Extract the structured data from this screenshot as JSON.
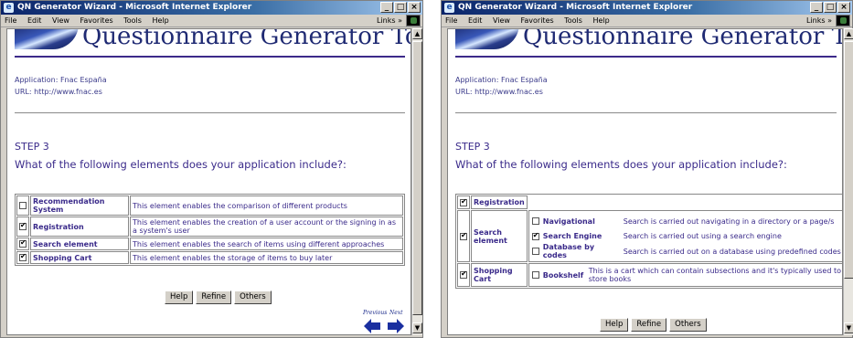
{
  "left": {
    "window_title": "QN Generator Wizard - Microsoft Internet Explorer",
    "menu": [
      "File",
      "Edit",
      "View",
      "Favorites",
      "Tools",
      "Help"
    ],
    "links_label": "Links »",
    "page_title": "Questionnaire Generator Tool",
    "application_line": "Application: Fnac España",
    "url_line": "URL: http://www.fnac.es",
    "step": "STEP 3",
    "question": "What of the following elements does your application include?:",
    "rows": [
      {
        "checked": false,
        "name": "Recommendation System",
        "desc": "This element enables the comparison of different products"
      },
      {
        "checked": true,
        "name": "Registration",
        "desc": "This element enables the creation of a user account or the signing in as a system's user"
      },
      {
        "checked": true,
        "name": "Search element",
        "desc": "This element enables the search of items using different approaches"
      },
      {
        "checked": true,
        "name": "Shopping Cart",
        "desc": "This element enables the storage of items to buy later"
      }
    ],
    "buttons": {
      "help": "Help",
      "refine": "Refine",
      "others": "Others"
    },
    "nav": {
      "previous": "Previous",
      "next": "Next"
    }
  },
  "right": {
    "window_title": "QN Generator Wizard - Microsoft Internet Explorer",
    "menu": [
      "File",
      "Edit",
      "View",
      "Favorites",
      "Tools",
      "Help"
    ],
    "links_label": "Links »",
    "page_title": "Questionnaire Generator Tool",
    "application_line": "Application: Fnac España",
    "url_line": "URL: http://www.fnac.es",
    "step": "STEP 3",
    "question": "What of the following elements does your application include?:",
    "registration": {
      "checked": true,
      "name": "Registration"
    },
    "search": {
      "checked": true,
      "name": "Search element",
      "options": [
        {
          "checked": false,
          "name": "Navigational",
          "desc": "Search is carried out navigating in a directory or a page/s"
        },
        {
          "checked": true,
          "name": "Search Engine",
          "desc": "Search is carried out using a search engine"
        },
        {
          "checked": false,
          "name": "Database by codes",
          "desc": "Search is carried out on a database using predefined codes"
        }
      ]
    },
    "cart": {
      "checked": true,
      "name": "Shopping Cart",
      "options": [
        {
          "checked": false,
          "name": "Bookshelf",
          "desc": "This is a cart which can contain subsections and it's typically used to store books"
        }
      ]
    },
    "buttons": {
      "help": "Help",
      "refine": "Refine",
      "others": "Others"
    }
  },
  "colors": {
    "accent_text": "#3a2a8a",
    "title_bar": "#0a246a",
    "heading": "#1f2a73"
  }
}
